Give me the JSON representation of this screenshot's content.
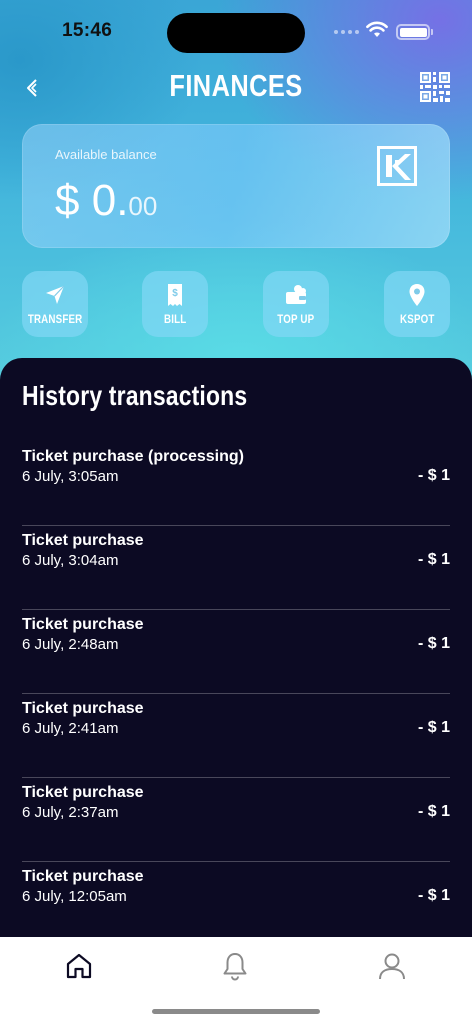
{
  "status_bar": {
    "time": "15:46"
  },
  "header": {
    "title": "FINANCES",
    "back_icon": "chevron-left-icon",
    "qr_icon": "qr-code-icon"
  },
  "balance": {
    "label": "Available balance",
    "currency": "$",
    "whole": "0.",
    "cents": "00"
  },
  "actions": [
    {
      "label": "TRANSFER",
      "icon": "paper-plane-icon"
    },
    {
      "label": "BILL",
      "icon": "receipt-icon"
    },
    {
      "label": "TOP UP",
      "icon": "wallet-icon"
    },
    {
      "label": "KSPOT",
      "icon": "location-pin-icon"
    }
  ],
  "history": {
    "title": "History transactions",
    "items": [
      {
        "title": "Ticket purchase (processing)",
        "date": "6 July, 3:05am",
        "amount": "- $ 1"
      },
      {
        "title": "Ticket purchase",
        "date": "6 July, 3:04am",
        "amount": "- $ 1"
      },
      {
        "title": "Ticket purchase",
        "date": "6 July, 2:48am",
        "amount": "- $ 1"
      },
      {
        "title": "Ticket purchase",
        "date": "6 July, 2:41am",
        "amount": "- $ 1"
      },
      {
        "title": "Ticket purchase",
        "date": "6 July, 2:37am",
        "amount": "- $ 1"
      },
      {
        "title": "Ticket purchase",
        "date": "6 July, 12:05am",
        "amount": "- $ 1"
      }
    ]
  },
  "tabbar": {
    "items": [
      "home-icon",
      "bell-icon",
      "user-icon"
    ]
  },
  "colors": {
    "panel": "#0c0a23",
    "accent": "#42b4dc"
  }
}
